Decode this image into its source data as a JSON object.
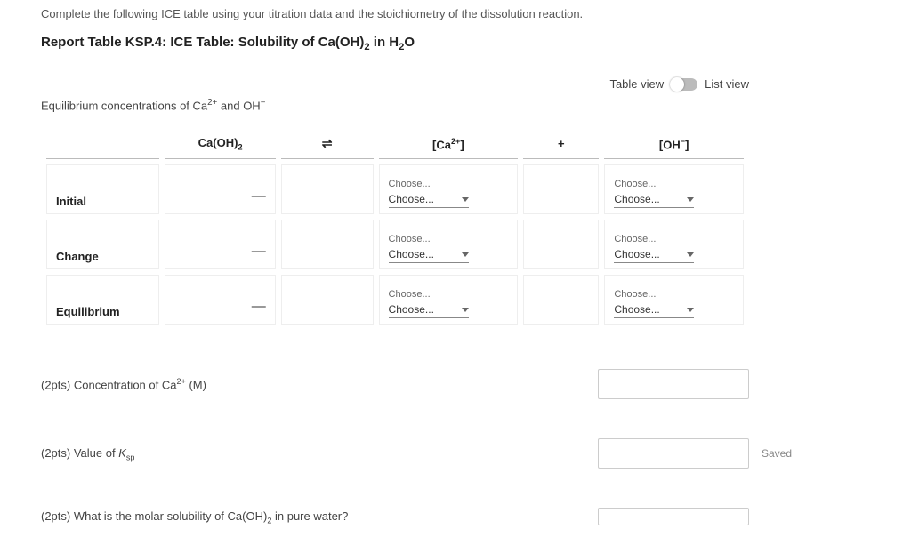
{
  "instruction": "Complete the following ICE table using your titration data and the stoichiometry of the dissolution reaction.",
  "report_title_pre": "Report Table KSP.4: ICE Table: Solubility of Ca(OH)",
  "report_title_sub": "2",
  "report_title_mid": " in H",
  "report_title_sub2": "2",
  "report_title_post": "O",
  "view": {
    "table": "Table view",
    "list": "List view"
  },
  "subheading_pre": "Equilibrium concentrations of Ca",
  "subheading_sup": "2+",
  "subheading_mid": " and OH",
  "subheading_sup2": "−",
  "headers": {
    "caoh_pre": "Ca(OH)",
    "caoh_sub": "2",
    "eq": "⇌",
    "ca_pre": "[Ca",
    "ca_sup": "2+",
    "ca_post": "]",
    "plus": "+",
    "oh_pre": "[OH",
    "oh_sup": "−",
    "oh_post": "]"
  },
  "rows": {
    "initial": "Initial",
    "change": "Change",
    "equilibrium": "Equilibrium",
    "dash": "—"
  },
  "choose": {
    "label": "Choose...",
    "value": "Choose..."
  },
  "questions": {
    "q1_pts": "(2pts)",
    "q1_pre": "  Concentration of Ca",
    "q1_sup": "2+",
    "q1_post": " (M)",
    "q2_pts": "(2pts)",
    "q2_pre": "  Value of ",
    "q2_i": "K",
    "q2_sub": "sp",
    "q3_pts": "(2pts)",
    "q3_pre": "  What is the molar solubility of Ca(OH)",
    "q3_sub": "2",
    "q3_post": " in pure water?"
  },
  "saved": "Saved"
}
